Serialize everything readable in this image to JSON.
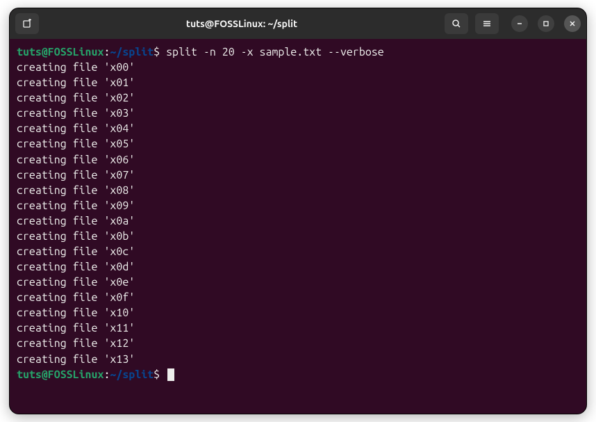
{
  "titlebar": {
    "title": "tuts@FOSSLinux: ~/split"
  },
  "prompt": {
    "user_host": "tuts@FOSSLinux",
    "separator": ":",
    "path": "~/split",
    "symbol": "$"
  },
  "command": "split -n 20 -x sample.txt --verbose",
  "output": [
    "creating file 'x00'",
    "creating file 'x01'",
    "creating file 'x02'",
    "creating file 'x03'",
    "creating file 'x04'",
    "creating file 'x05'",
    "creating file 'x06'",
    "creating file 'x07'",
    "creating file 'x08'",
    "creating file 'x09'",
    "creating file 'x0a'",
    "creating file 'x0b'",
    "creating file 'x0c'",
    "creating file 'x0d'",
    "creating file 'x0e'",
    "creating file 'x0f'",
    "creating file 'x10'",
    "creating file 'x11'",
    "creating file 'x12'",
    "creating file 'x13'"
  ]
}
